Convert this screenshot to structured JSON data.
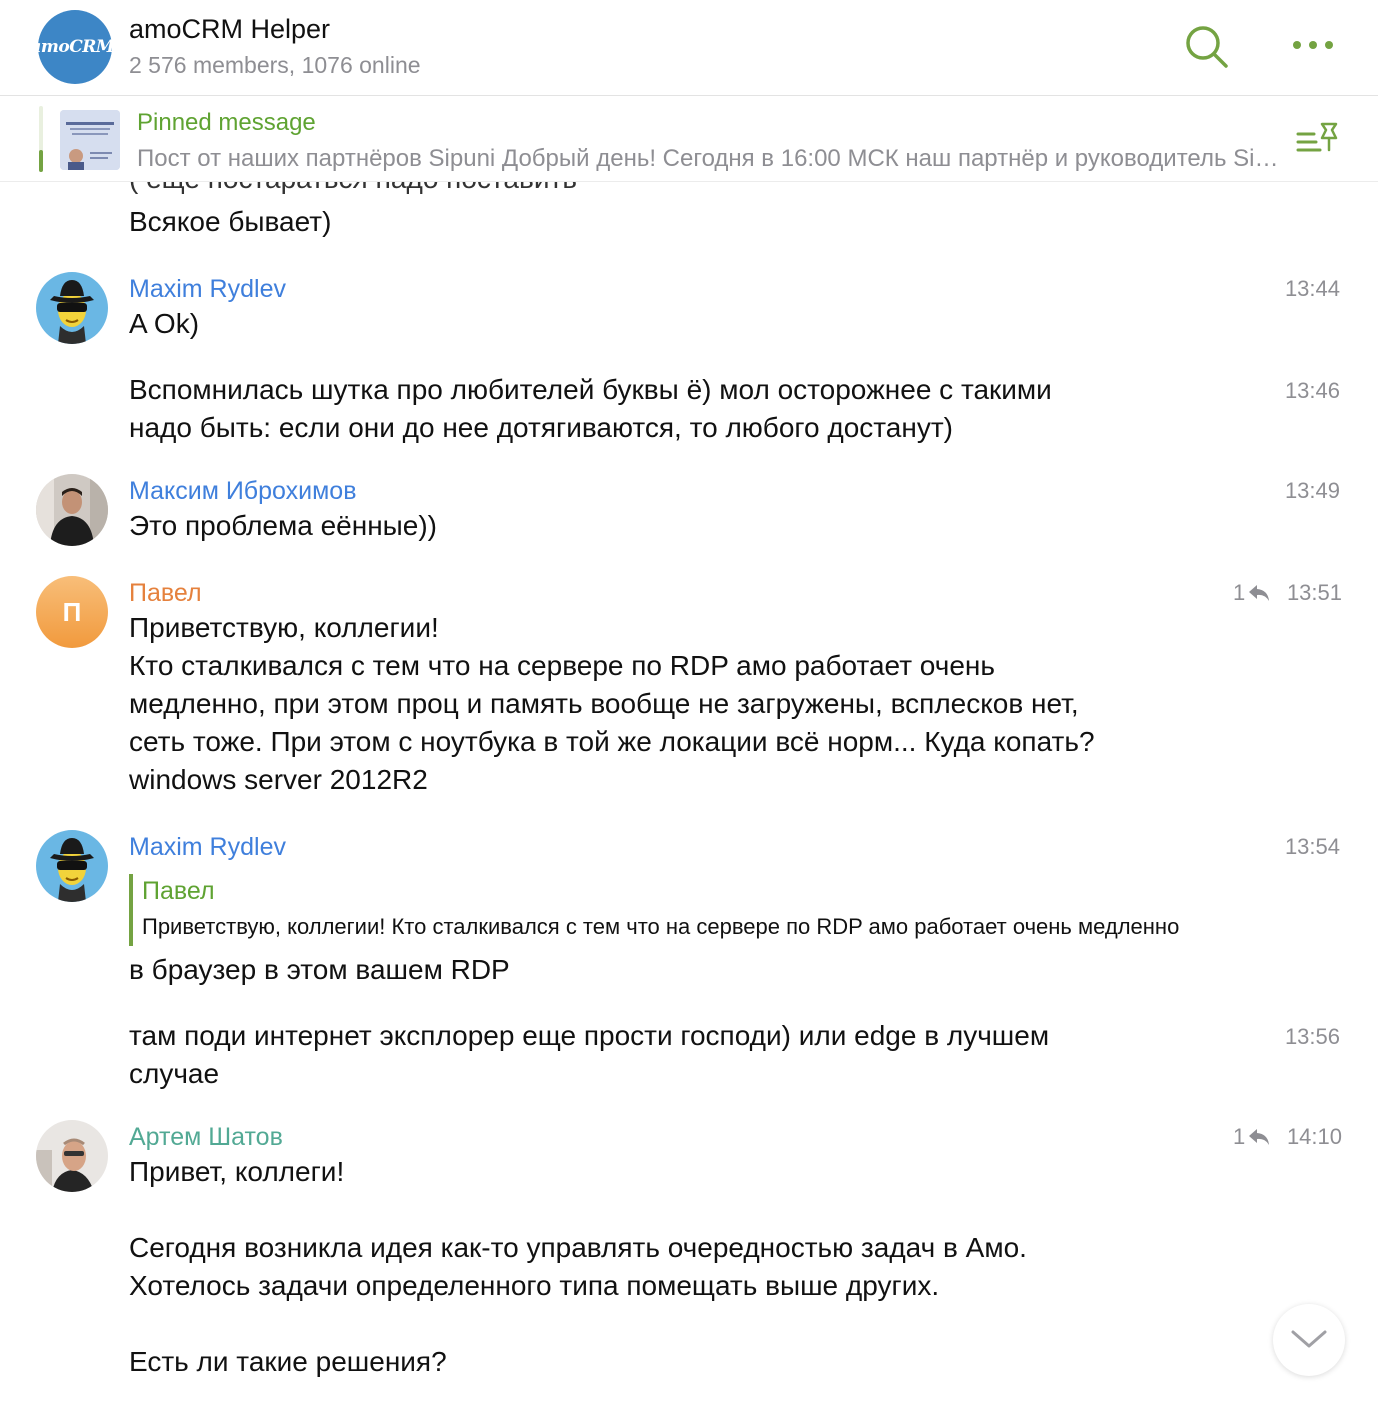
{
  "header": {
    "avatar_text": "amoCRM.",
    "title": "amoCRM Helper",
    "subtitle": "2 576 members, 1076 online",
    "search_icon": "search-icon",
    "more_icon": "more-dots-icon"
  },
  "pinned": {
    "title": "Pinned message",
    "text": "Пост от наших партнёров Sipuni  Добрый день!  Сегодня в 16:00 МСК наш партнёр и руководитель Sipuni",
    "list_icon": "pin-list-icon"
  },
  "colors": {
    "accent_green": "#74a342",
    "name_blue": "#3f7fdc",
    "name_orange": "#e5813d",
    "name_teal": "#52a994"
  },
  "messages": [
    {
      "cut_text": "( еще постараться надо поставить",
      "text": "Всякое бывает)"
    },
    {
      "sender": "Maxim Rydlev",
      "time": "13:44",
      "text": "A Ok)"
    },
    {
      "time": "13:46",
      "text": "Вспомнилась шутка про любителей буквы ё) мол осторожнее с такими\nнадо быть: если они до нее дотягиваются, то любого достанут)"
    },
    {
      "sender": "Максим Иброхимов",
      "time": "13:49",
      "text": "Это проблема eённые))"
    },
    {
      "sender": "Павел",
      "avatar_letter": "П",
      "replies": "1",
      "time": "13:51",
      "text": "Приветствую, коллегии!\nКто сталкивался с тем что на сервере по RDP амо работает очень\nмедленно, при этом проц и память вообще не загружены, всплесков нет,\nсеть тоже. При этом с ноутбука в той же локации всё норм... Куда копать?\nwindows server 2012R2"
    },
    {
      "sender": "Maxim Rydlev",
      "time": "13:54",
      "quote_name": "Павел",
      "quote_text": "Приветствую, коллегии! Кто сталкивался с тем что на сервере по RDP амо работает очень медленно",
      "text": "в браузер в этом вашем RDP"
    },
    {
      "time": "13:56",
      "text": "там поди интернет эксплорер еще прости господи) или edge в лучшем\nслучае"
    },
    {
      "sender": "Артем Шатов",
      "replies": "1",
      "time": "14:10",
      "text": "Привет, коллеги!\n\nСегодня возникла идея как-то управлять очередностью задач в Амо.\nХотелось задачи определенного типа помещать выше других.\n\nЕсть ли такие решения?"
    }
  ],
  "scroll_down_icon": "chevron-down-icon"
}
